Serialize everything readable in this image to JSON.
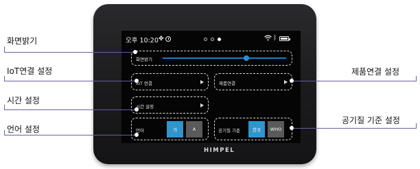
{
  "status": {
    "time": "오후 10:20"
  },
  "screen": {
    "brightness_label": "화면밝기",
    "brightness_level": 0.68,
    "iot_label": "IoT 연결",
    "product_label": "제품연결",
    "time_label": "시간 설정",
    "language_label": "언어",
    "lang_options": [
      "가",
      "A"
    ],
    "air_label": "공기질 기준",
    "air_options": [
      "한국",
      "WHO"
    ]
  },
  "brand": "HIMPEL",
  "callouts": {
    "brightness": "화면밝기",
    "iot": "IoT연결  설정",
    "time": "시간 설정",
    "language": "언어 설정",
    "product": "제품연결 설정",
    "air": "공기질 기준 설정"
  },
  "colors": {
    "accent": "#2f95cc",
    "callout_line": "#6f5aa0"
  }
}
